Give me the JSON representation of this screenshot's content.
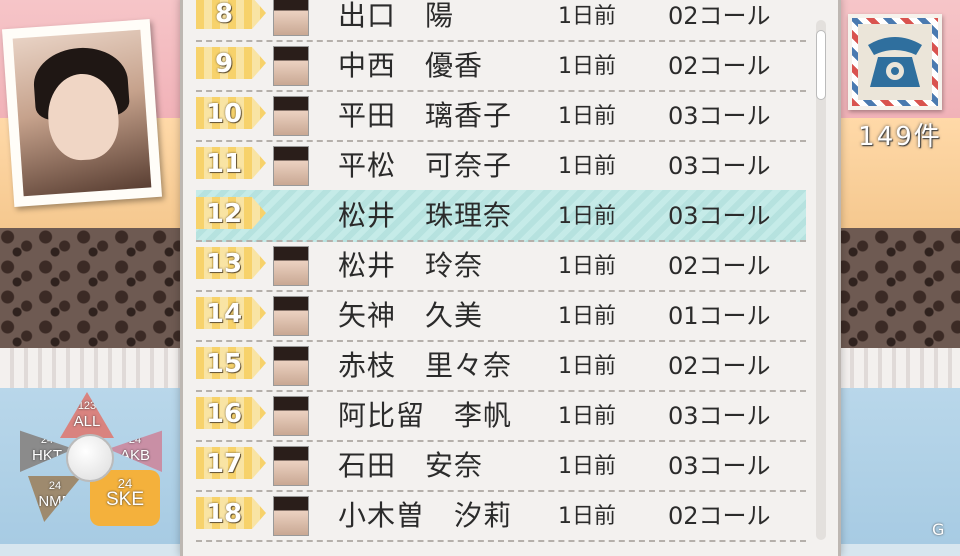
{
  "contacts": [
    {
      "num": "8",
      "name": "出口　陽",
      "date": "1日前",
      "calls": "02コール",
      "selected": false
    },
    {
      "num": "9",
      "name": "中西　優香",
      "date": "1日前",
      "calls": "02コール",
      "selected": false
    },
    {
      "num": "10",
      "name": "平田　璃香子",
      "date": "1日前",
      "calls": "03コール",
      "selected": false
    },
    {
      "num": "11",
      "name": "平松　可奈子",
      "date": "1日前",
      "calls": "03コール",
      "selected": false
    },
    {
      "num": "12",
      "name": "松井　珠理奈",
      "date": "1日前",
      "calls": "03コール",
      "selected": true
    },
    {
      "num": "13",
      "name": "松井　玲奈",
      "date": "1日前",
      "calls": "02コール",
      "selected": false
    },
    {
      "num": "14",
      "name": "矢神　久美",
      "date": "1日前",
      "calls": "01コール",
      "selected": false
    },
    {
      "num": "15",
      "name": "赤枝　里々奈",
      "date": "1日前",
      "calls": "02コール",
      "selected": false
    },
    {
      "num": "16",
      "name": "阿比留　李帆",
      "date": "1日前",
      "calls": "03コール",
      "selected": false
    },
    {
      "num": "17",
      "name": "石田　安奈",
      "date": "1日前",
      "calls": "03コール",
      "selected": false
    },
    {
      "num": "18",
      "name": "小木曽　汐莉",
      "date": "1日前",
      "calls": "02コール",
      "selected": false
    }
  ],
  "count_label": "149件",
  "groups": {
    "all": {
      "count": "123",
      "label": "ALL"
    },
    "hkt": {
      "count": "24",
      "label": "HKT"
    },
    "akb": {
      "count": "24",
      "label": "AKB"
    },
    "nmb": {
      "count": "24",
      "label": "NMB"
    },
    "ske": {
      "count": "24",
      "label": "SKE"
    }
  },
  "watermark": "G",
  "icons": {
    "phone": "phone-icon",
    "center": "center-button"
  },
  "colors": {
    "selected_row": "#c5ebe8",
    "num_tag": "#f7d26b",
    "phone": "#2f6f9e"
  }
}
